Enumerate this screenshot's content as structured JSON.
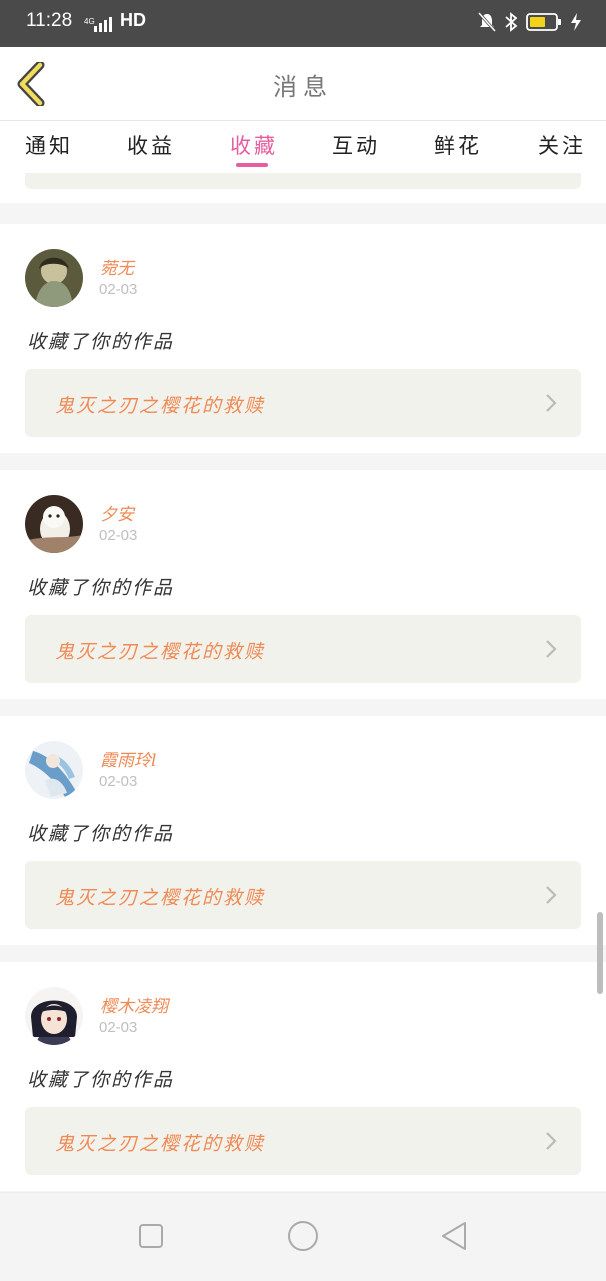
{
  "status_bar": {
    "time": "11:28",
    "network": "4G",
    "hd": "HD",
    "icons": [
      "mute-icon",
      "bluetooth-icon",
      "battery-icon",
      "charging-icon"
    ]
  },
  "header": {
    "title": "消息",
    "back_icon": "chevron-left-icon"
  },
  "tabs": [
    {
      "label": "通知",
      "active": false
    },
    {
      "label": "收益",
      "active": false
    },
    {
      "label": "收藏",
      "active": true
    },
    {
      "label": "互动",
      "active": false
    },
    {
      "label": "鲜花",
      "active": false
    },
    {
      "label": "关注",
      "active": false
    }
  ],
  "colors": {
    "accent": "#e55fa0",
    "name_orange": "#ef8a55",
    "card_box": "#f2f2ec"
  },
  "notifications": [
    {
      "username": "菀无",
      "date": "02-03",
      "action": "收藏了你的作品",
      "work_title": "鬼灭之刃之樱花的救赎"
    },
    {
      "username": "夕安",
      "date": "02-03",
      "action": "收藏了你的作品",
      "work_title": "鬼灭之刃之樱花的救赎"
    },
    {
      "username": "霞雨玲l",
      "date": "02-03",
      "action": "收藏了你的作品",
      "work_title": "鬼灭之刃之樱花的救赎"
    },
    {
      "username": "樱木凌翔",
      "date": "02-03",
      "action": "收藏了你的作品",
      "work_title": "鬼灭之刃之樱花的救赎"
    }
  ],
  "nav_bar": [
    "square-icon",
    "circle-icon",
    "triangle-back-icon"
  ]
}
